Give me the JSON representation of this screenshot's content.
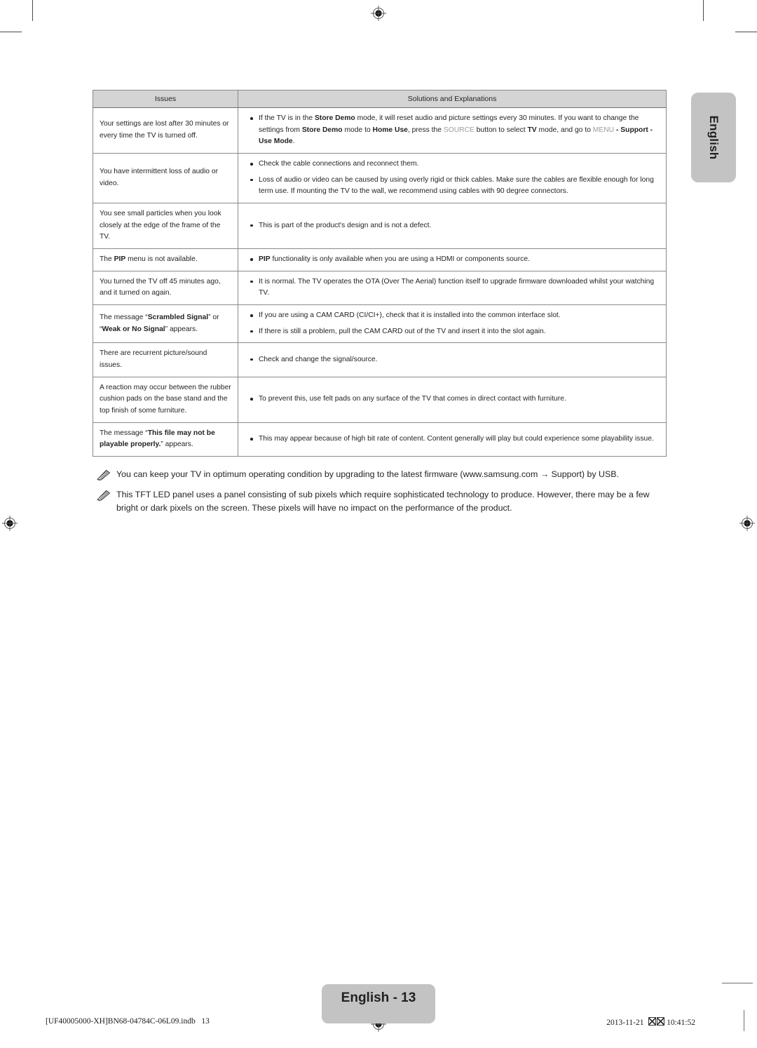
{
  "side_tab": {
    "label": "English"
  },
  "table": {
    "headers": [
      "Issues",
      "Solutions and Explanations"
    ],
    "rows": [
      {
        "issue_html": "Your settings are lost after 30 minutes or every time the TV is turned off.",
        "solutions_html": [
          "If the TV is in the <b>Store Demo</b> mode, it will reset audio and picture settings every 30 minutes. If you want to change the settings from <b>Store Demo</b> mode to <b>Home Use</b>, press the <span class=\"keyname\">SOURCE</span> button to select <b>TV</b> mode, and go to <span class=\"keyname\">MENU</span> <b>- Support - Use Mode</b>."
        ]
      },
      {
        "issue_html": "You have intermittent loss of audio or video.",
        "solutions_html": [
          "Check the cable connections and reconnect them.",
          "Loss of audio or video can be caused by using overly rigid or thick cables. Make sure the cables are flexible enough for long term use. If mounting the TV to the wall, we recommend using cables with 90 degree connectors."
        ]
      },
      {
        "issue_html": "You see small particles when you look closely at the edge of the frame of the TV.",
        "solutions_html": [
          "This is part of the product's design and is not a defect."
        ]
      },
      {
        "issue_html": "The <b>PIP</b> menu is not available.",
        "solutions_html": [
          "<b>PIP</b> functionality is only available when you are using a HDMI or components source."
        ]
      },
      {
        "issue_html": "You turned the TV off 45 minutes ago, and it turned on again.",
        "solutions_html": [
          "It is normal. The TV operates the OTA (Over The Aerial) function itself to upgrade firmware downloaded whilst your watching TV."
        ]
      },
      {
        "issue_html": "The message “<b>Scrambled Signal</b>” or “<b>Weak or No Signal</b>” appears.",
        "solutions_html": [
          "If you are using a CAM CARD (CI/CI+), check that it is installed into the common interface slot.",
          "If there is still a problem, pull the CAM CARD out of the TV and insert it into the slot again."
        ]
      },
      {
        "issue_html": "There are recurrent picture/sound issues.",
        "solutions_html": [
          "Check and change the signal/source."
        ]
      },
      {
        "issue_html": "A reaction may occur between the rubber cushion pads on the base stand and the top finish of some furniture.",
        "solutions_html": [
          "To prevent this, use felt pads on any surface of the TV that comes in direct contact with furniture."
        ]
      },
      {
        "issue_html": "The message “<b>This file may not be playable properly.</b>” appears.",
        "solutions_html": [
          "This may appear because of high bit rate of content. Content generally will play but could experience some playability issue."
        ]
      }
    ]
  },
  "notes": [
    {
      "icon": "pencil-note-icon",
      "text": "You can keep your TV in optimum operating condition by upgrading to the latest firmware (www.samsung.com → Support) by USB."
    },
    {
      "icon": "pencil-note-icon",
      "text": "This TFT LED panel uses a panel consisting of sub pixels which require sophisticated technology to produce. However, there may be a few bright or dark pixels on the screen. These pixels will have no impact on the performance of the product."
    }
  ],
  "page_badge": {
    "label": "English - 13"
  },
  "footer": {
    "left": "[UF40005000-XH]BN68-04784C-06L09.indb   13",
    "date": "2013-11-21",
    "time": "10:41:52"
  },
  "colors": {
    "tab_grey": "#c3c3c3",
    "header_grey": "#d4d4d4",
    "text": "#231f20",
    "key_grey": "#9c9c9c",
    "border": "#8a8a8a"
  }
}
